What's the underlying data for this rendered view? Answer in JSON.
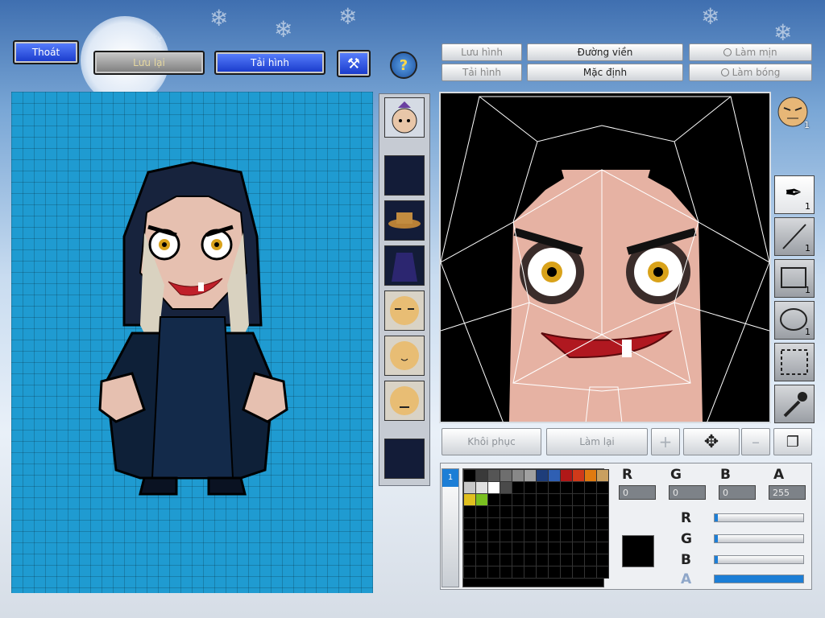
{
  "toolbar": {
    "exit_label": "Thoát",
    "save_label": "Lưu lại",
    "reload_label": "Tải hình"
  },
  "options": {
    "save_image_label": "Lưu hình",
    "reload_image_label": "Tải hình",
    "outline_label": "Đường viền",
    "default_label": "Mặc định",
    "smooth_label": "Làm mịn",
    "shade_label": "Làm bóng"
  },
  "tools": {
    "brush_count": "1",
    "line_count": "1",
    "rect_count": "1",
    "ellipse_count": "1",
    "face_badge_count": "1"
  },
  "actions": {
    "restore_label": "Khôi phục",
    "redo_label": "Làm lại"
  },
  "color": {
    "r_label": "R",
    "g_label": "G",
    "b_label": "B",
    "a_label": "A",
    "r_value": "0",
    "g_value": "0",
    "b_value": "0",
    "a_value": "255",
    "current": "#000000",
    "slider_r": 0.04,
    "slider_g": 0.04,
    "slider_b": 0.04,
    "slider_a": 1.0
  },
  "palette": [
    "#000000",
    "#3a3a3a",
    "#555555",
    "#6e6e6e",
    "#888888",
    "#a0a0a0",
    "#1e3d7a",
    "#2f5fb3",
    "#b01818",
    "#d03a1a",
    "#e07a10",
    "#c9a060",
    "#c8c8c8",
    "#e0e0e0",
    "#ffffff",
    "#4a4a4a",
    "#000000",
    "#000000",
    "#000000",
    "#000000",
    "#000000",
    "#000000",
    "#000000",
    "#000000",
    "#e0c020",
    "#7ac020",
    "#000000",
    "#000000",
    "#000000",
    "#000000",
    "#000000",
    "#000000",
    "#000000",
    "#000000",
    "#000000",
    "#000000"
  ]
}
